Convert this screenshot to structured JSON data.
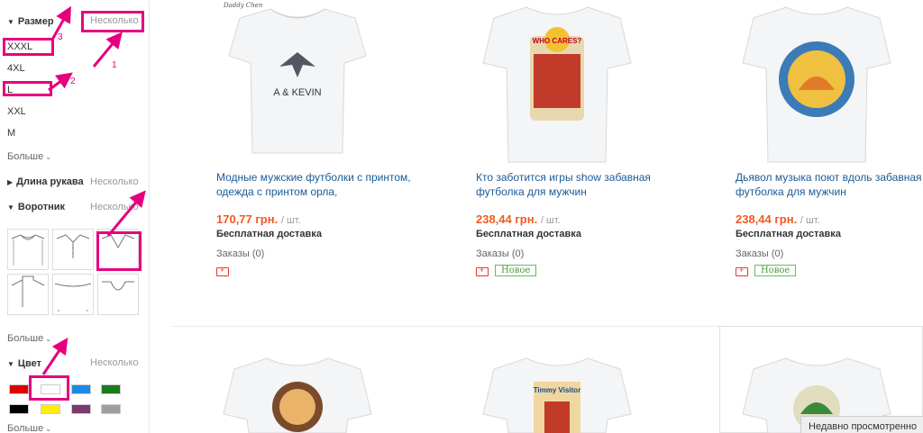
{
  "sidebar": {
    "size": {
      "title": "Размер",
      "multi": "Несколько",
      "options": [
        "XXXL",
        "4XL",
        "L",
        "XXL",
        "M"
      ],
      "more": "Больше"
    },
    "sleeve": {
      "title": "Длина рукава",
      "multi": "Несколько"
    },
    "collar": {
      "title": "Воротник",
      "multi": "Несколько",
      "more": "Больше"
    },
    "color": {
      "title": "Цвет",
      "multi": "Несколько",
      "swatches": [
        "#e00000",
        "#ffffff",
        "#1e88e5",
        "#1b7a1b",
        "#000000",
        "#ffee00",
        "#7b3a6e",
        "#9e9e9e"
      ],
      "more": "Больше"
    }
  },
  "annotations": {
    "label_1": "1",
    "label_2": "2",
    "label_3": "3",
    "color": "#e6007e"
  },
  "products": [
    {
      "title": "Модные мужские футболки с принтом, одежда с принтом орла,",
      "price": "170,77 грн.",
      "unit": "/ шт.",
      "shipping": "Бесплатная доставка",
      "orders": "Заказы (0)",
      "new": "",
      "print_text": "A & KEVIN",
      "brand": "Daddy Chen"
    },
    {
      "title": "Кто заботится игры show забавная футболка для мужчин",
      "price": "238,44 грн.",
      "unit": "/ шт.",
      "shipping": "Бесплатная доставка",
      "orders": "Заказы (0)",
      "new": "Новое",
      "print_text": "WHO CARES?"
    },
    {
      "title": "Дьявол музыка поют вдоль забавная футболка для мужчин",
      "price": "238,44 грн.",
      "unit": "/ шт.",
      "shipping": "Бесплатная доставка",
      "orders": "Заказы (0)",
      "new": "Новое",
      "print_text": ""
    },
    {
      "print_text": ""
    },
    {
      "print_text": "Timmy Visitor"
    },
    {
      "print_text": ""
    }
  ],
  "recently_viewed": "Недавно просмотренно"
}
